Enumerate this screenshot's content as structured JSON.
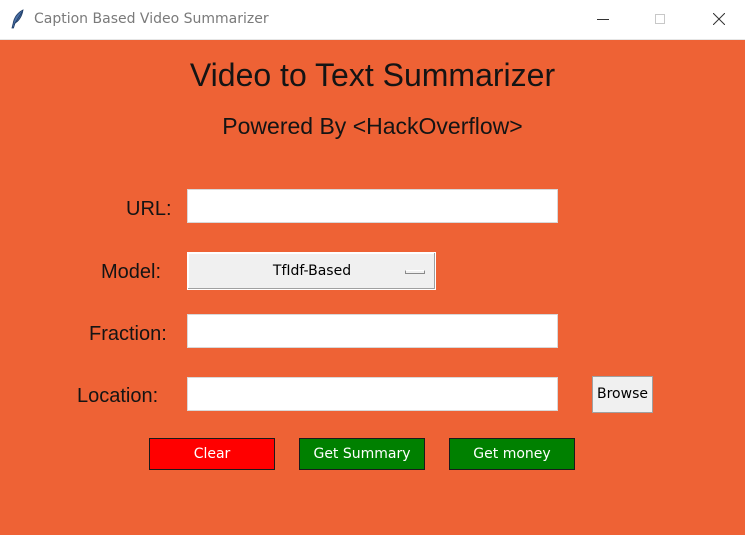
{
  "window": {
    "title": "Caption Based Video Summarizer"
  },
  "header": {
    "title": "Video to Text Summarizer",
    "subtitle": "Powered By <HackOverflow>"
  },
  "form": {
    "url_label": "URL:",
    "url_value": "",
    "model_label": "Model:",
    "model_selected": "TfIdf-Based",
    "fraction_label": "Fraction:",
    "fraction_value": "",
    "location_label": "Location:",
    "location_value": "",
    "browse_label": "Browse"
  },
  "actions": {
    "clear_label": "Clear",
    "summary_label": "Get Summary",
    "money_label": "Get money"
  },
  "colors": {
    "background": "#ee6235",
    "clear_button": "#ff0000",
    "summary_button": "#008000",
    "money_button": "#008000"
  },
  "icons": {
    "app": "feather-icon",
    "minimize": "minimize-icon",
    "maximize": "maximize-icon",
    "close": "close-icon"
  }
}
